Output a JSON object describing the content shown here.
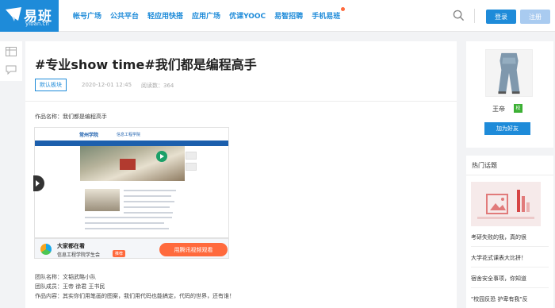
{
  "header": {
    "logo_text": "易班",
    "logo_sub": "yiban.cn",
    "nav": [
      "帐号广场",
      "公共平台",
      "轻应用快搭",
      "应用广场",
      "优课YOOC",
      "易智招聘",
      "手机易班"
    ],
    "login_label": "登录",
    "register_label": "注册",
    "accent_color": "#1e8bd9"
  },
  "post": {
    "title": "#专业show time#我们都是编程高手",
    "tag": "默认板块",
    "date": "2020-12-01 12:45",
    "reads": "阅读数：364",
    "work_name": "作品名称：我们都是编程高手",
    "team_name": "团队名称：文韬武略小队",
    "team_members": "团队成员：王帝 徐君 王书民",
    "content": "作品内容：其实你们用笔画的图案，我们用代码也能搞定，代码的世界，还有谁！"
  },
  "embedded_site": {
    "logo": "常州学院",
    "sub": "信息工程学院"
  },
  "video_banner": {
    "line1": "大家都在看",
    "line2": "信息工程学院学生会",
    "badge": "推荐",
    "watch_label": "用腾讯视频观看"
  },
  "profile": {
    "name": "王帝",
    "school_badge": "校",
    "add_friend_label": "加为好友"
  },
  "hot_topics": {
    "heading": "热门话题",
    "items": [
      "考研失败的我，真的很",
      "大学花式课表大比拼！",
      "宿舍安全事项，你知道",
      "\"校园反恐 护卑有我\"反"
    ]
  }
}
